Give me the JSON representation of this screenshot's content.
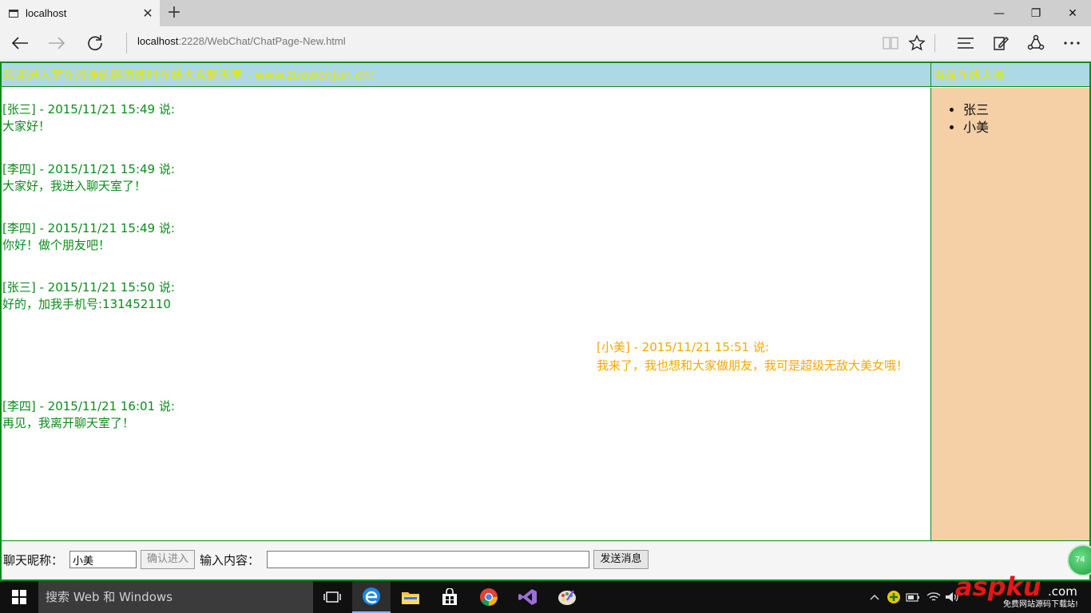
{
  "browser": {
    "tab_title": "localhost",
    "close_glyph": "✕",
    "newtab_glyph": "+",
    "url_host": "localhost",
    "url_path": ":2228/WebChat/ChatPage-New.html",
    "win_min": "—",
    "win_restore": "❐",
    "win_close": "✕"
  },
  "page": {
    "header_title": "欢迎进入梦在旅途的网页即时在线大众聊天室 - www.zuowenjun.cn：",
    "online_title": "当前在线人员",
    "online_users": [
      "张三",
      "小美"
    ],
    "messages": [
      {
        "meta": "[张三] - 2015/11/21 15:49 说:",
        "text": "大家好！",
        "side": "left"
      },
      {
        "meta": "[李四] - 2015/11/21 15:49 说:",
        "text": "大家好，我进入聊天室了！",
        "side": "left"
      },
      {
        "meta": "[李四] - 2015/11/21 15:49 说:",
        "text": "你好！做个朋友吧！",
        "side": "left"
      },
      {
        "meta": "[张三] - 2015/11/21 15:50 说:",
        "text": "好的，加我手机号:131452110",
        "side": "left"
      },
      {
        "meta": "[小美] - 2015/11/21 15:51 说:",
        "text": "我来了，我也想和大家做朋友，我可是超级无敌大美女哦！",
        "side": "right"
      },
      {
        "meta": "[李四] - 2015/11/21 16:01 说:",
        "text": "再见，我离开聊天室了！",
        "side": "left"
      }
    ],
    "footer": {
      "nickname_label": "聊天昵称：",
      "nickname_value": "小美",
      "confirm_button": "确认进入",
      "content_label": "输入内容：",
      "content_value": "",
      "send_button": "发送消息",
      "badge_text": "74"
    }
  },
  "taskbar": {
    "search_placeholder": "搜索 Web 和 Windows",
    "icons": [
      "task-view-icon",
      "edge-icon",
      "file-explorer-icon",
      "store-icon",
      "chrome-icon",
      "visual-studio-icon",
      "paint-icon"
    ]
  },
  "watermark": {
    "brand": "aspku",
    "suffix": ".com",
    "tagline": "免费网站源码下载站!"
  },
  "colors": {
    "border": "#0f8a1e",
    "header_bg": "#add8e6",
    "header_text": "#e8e800",
    "users_bg": "#f5cfa5",
    "msg_left": "#0f8a1e",
    "msg_right": "#f5a800"
  }
}
